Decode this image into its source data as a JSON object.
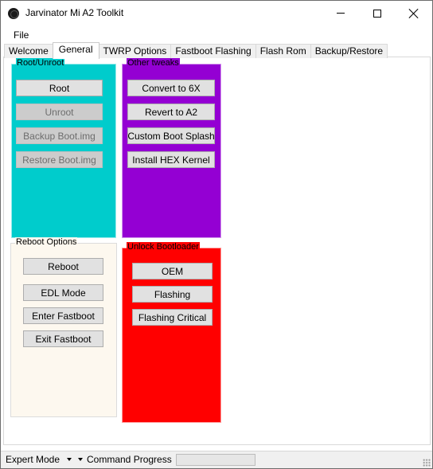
{
  "window": {
    "title": "Jarvinator Mi A2 Toolkit",
    "icon": "app-logo-icon"
  },
  "menu": {
    "file": "File"
  },
  "tabs": [
    "Welcome",
    "General",
    "TWRP Options",
    "Fastboot Flashing",
    "Flash Rom",
    "Backup/Restore"
  ],
  "active_tab": "General",
  "groups": {
    "root": {
      "title": "Root/Unroot",
      "color": "#00cccc",
      "buttons": [
        "Root",
        "Unroot",
        "Backup Boot.img",
        "Restore Boot.img"
      ],
      "disabled": [
        "Unroot",
        "Backup Boot.img",
        "Restore Boot.img"
      ]
    },
    "tweaks": {
      "title": "Other tweaks",
      "color": "#9400d3",
      "buttons": [
        "Convert to 6X",
        "Revert to A2",
        "Custom Boot Splash",
        "Install HEX Kernel"
      ]
    },
    "reboot": {
      "title": "Reboot Options",
      "color": "#fdf8ef",
      "buttons": [
        "Reboot",
        "EDL Mode",
        "Enter Fastboot",
        "Exit Fastboot"
      ]
    },
    "unlock": {
      "title": "Unlock Bootloader",
      "color": "#ff0000",
      "buttons": [
        "OEM",
        "Flashing",
        "Flashing Critical"
      ]
    }
  },
  "status": {
    "expert_mode": "Expert Mode",
    "command_progress": "Command Progress",
    "progress": 0
  }
}
